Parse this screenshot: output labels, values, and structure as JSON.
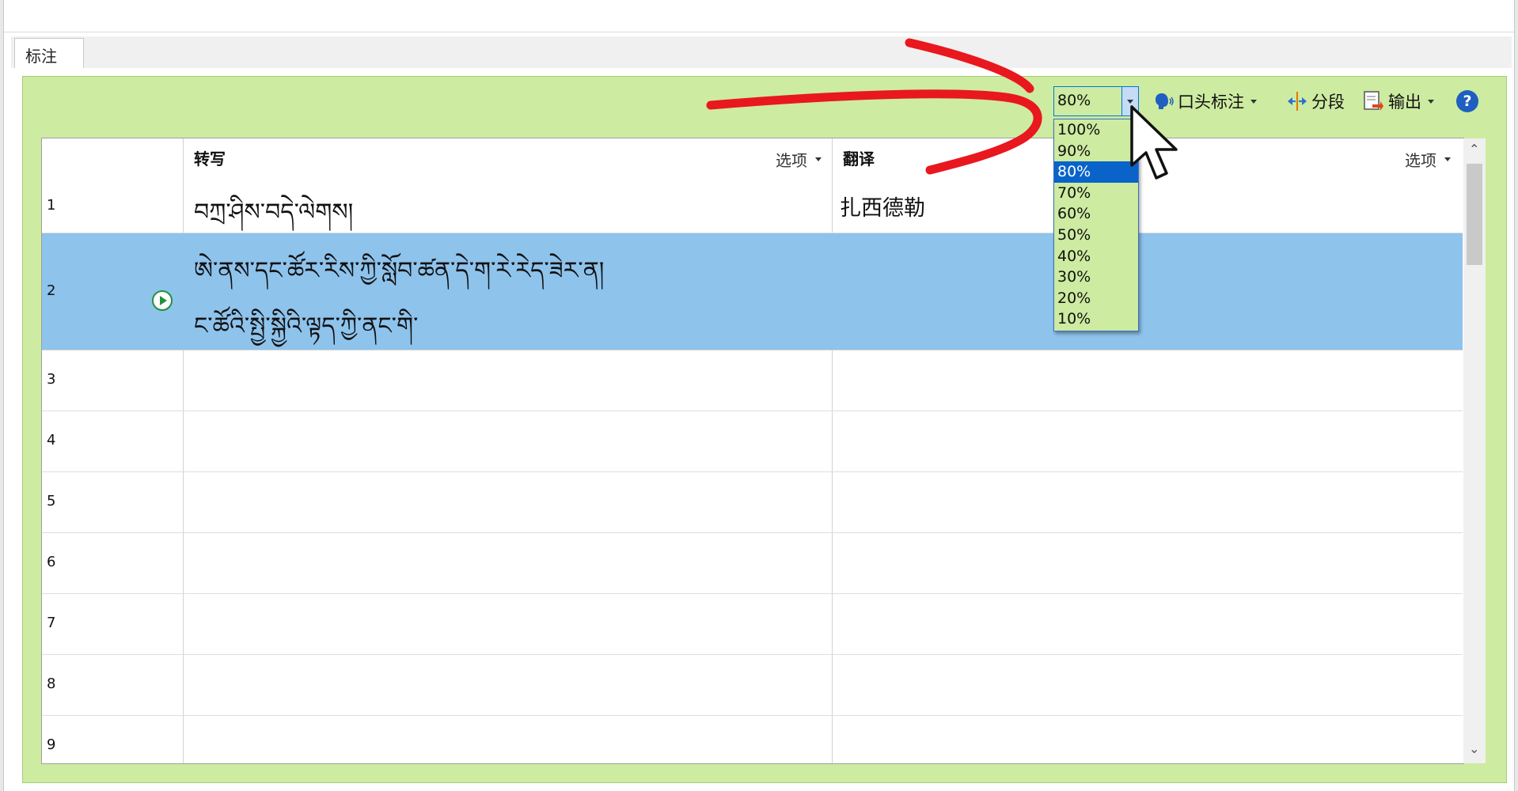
{
  "tab": {
    "label": "标注"
  },
  "toolbar": {
    "zoom_value": "80%",
    "oral_label": "口头标注",
    "segment_label": "分段",
    "output_label": "输出",
    "help_label": "?"
  },
  "zoom_options": [
    "100%",
    "90%",
    "80%",
    "70%",
    "60%",
    "50%",
    "40%",
    "30%",
    "20%",
    "10%"
  ],
  "zoom_selected": "80%",
  "grid": {
    "columns": {
      "transcription": "转写",
      "translation": "翻译",
      "options": "选项"
    },
    "rows": [
      {
        "num": "1",
        "tibetan": [
          "བཀྲ་ཤིས་བདེ་ལེགས།"
        ],
        "translation": "扎西德勒"
      },
      {
        "num": "2",
        "tibetan": [
          "ཨེ་ནས་དང་ཚོར་རིས་ཀྱི་སློབ་ཚན་དེ་ག་རེ་རེད་ཟེར་ན།",
          "ང་ཚོའི་སྤྱི་སྐྱིའི་ལྟད་ཀྱི་ནང་གི་"
        ],
        "translation": ""
      },
      {
        "num": "3",
        "tibetan": [],
        "translation": ""
      },
      {
        "num": "4",
        "tibetan": [],
        "translation": ""
      },
      {
        "num": "5",
        "tibetan": [],
        "translation": ""
      },
      {
        "num": "6",
        "tibetan": [],
        "translation": ""
      },
      {
        "num": "7",
        "tibetan": [],
        "translation": ""
      },
      {
        "num": "8",
        "tibetan": [],
        "translation": ""
      },
      {
        "num": "9",
        "tibetan": [],
        "translation": ""
      }
    ]
  },
  "colors": {
    "panel_green": "#cdeba1",
    "selected_row": "#8ec3ec",
    "selected_option": "#0a63c9",
    "annotation_red": "#e8181e",
    "play_green": "#23923a"
  }
}
